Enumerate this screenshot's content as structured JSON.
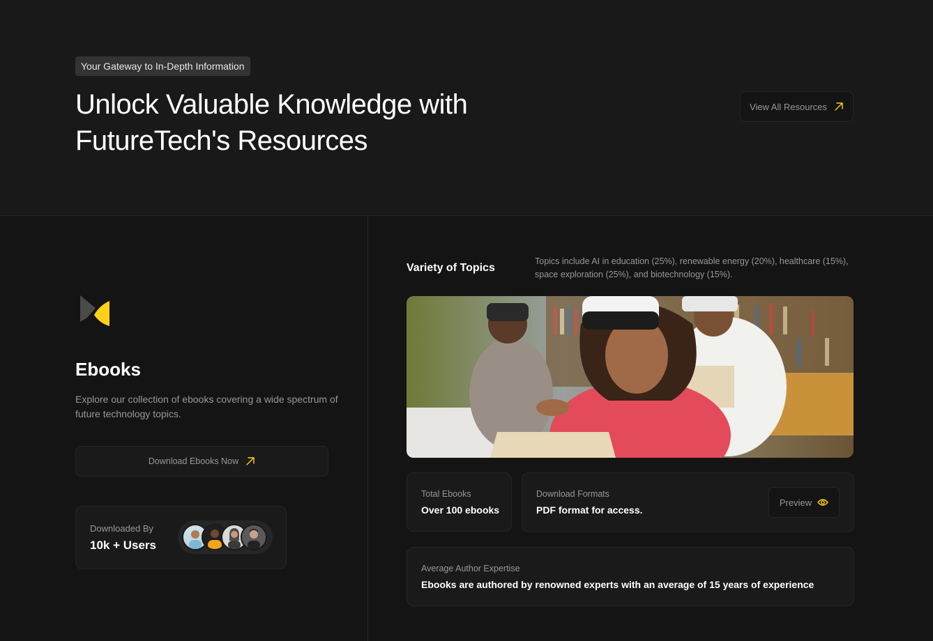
{
  "hero": {
    "tagline": "Your Gateway to In-Depth Information",
    "title_line1": "Unlock Valuable Knowledge with",
    "title_line2": "FutureTech's Resources",
    "view_all_label": "View All Resources"
  },
  "ebooks": {
    "title": "Ebooks",
    "description": "Explore our collection of ebooks covering a wide spectrum of future technology topics.",
    "download_label": "Download Ebooks Now",
    "downloaded_by_label": "Downloaded By",
    "downloaded_by_value": "10k + Users"
  },
  "details": {
    "topics_title": "Variety of Topics",
    "topics_description": "Topics include AI in education (25%), renewable energy (20%), healthcare (15%), space exploration (25%), and biotechnology (15%).",
    "total_label": "Total Ebooks",
    "total_value": "Over 100 ebooks",
    "formats_label": "Download Formats",
    "formats_value": "PDF format for access.",
    "preview_label": "Preview",
    "expertise_label": "Average Author Expertise",
    "expertise_value": "Ebooks are authored by renowned experts with an average of 15 years of experience"
  },
  "colors": {
    "accent": "#ffd11a",
    "background": "#141414",
    "card": "#1a1a1a",
    "border": "#262626",
    "muted_text": "#98989a"
  },
  "icons": {
    "arrow": "arrow-up-right-icon",
    "eye": "eye-icon",
    "logo": "ebook-logo-icon"
  }
}
